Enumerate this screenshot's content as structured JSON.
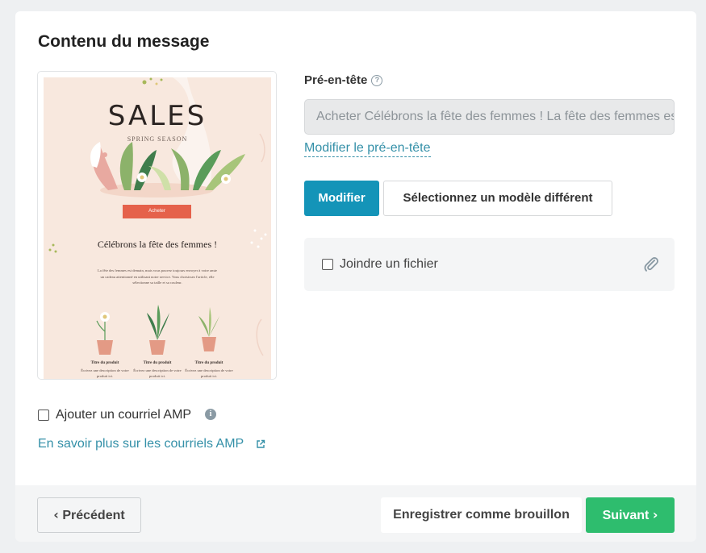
{
  "section": {
    "title": "Contenu du message"
  },
  "preview": {
    "sales_title": "SALES",
    "sales_subtitle": "SPRING SEASON",
    "button_label": "Acheter",
    "headline": "Célébrons la fête des femmes !",
    "body": "La fête des femmes est demain, mais vous pouvez toujours envoyer à votre amie un cadeau attentionné en utilisant notre service. Vous choisissez l'article, elle sélectionne sa taille et sa couleur.",
    "products": [
      {
        "title": "Titre du produit",
        "desc": "Écrivez une description de votre produit ici."
      },
      {
        "title": "Titre du produit",
        "desc": "Écrivez une description de votre produit ici."
      },
      {
        "title": "Titre du produit",
        "desc": "Écrivez une description de votre produit ici."
      }
    ],
    "colors": {
      "background": "#f8e8de",
      "button": "#e5614b"
    }
  },
  "preheader": {
    "label": "Pré-en-tête",
    "help_icon": "question-circle-icon",
    "value": "Acheter Célébrons la fête des femmes ! La fête des femmes est demain",
    "edit_link": "Modifier le pré-en-tête"
  },
  "actions": {
    "modify": "Modifier",
    "select_template": "Sélectionnez un modèle différent"
  },
  "attachment": {
    "label": "Joindre un fichier",
    "checked": false,
    "icon": "paperclip-icon"
  },
  "amp": {
    "label": "Ajouter un courriel AMP",
    "checked": false,
    "info_icon": "info-icon",
    "learn_more": "En savoir plus sur les courriels AMP",
    "external_icon": "external-link-icon"
  },
  "footer": {
    "previous": "Précédent",
    "save_draft": "Enregistrer comme brouillon",
    "next": "Suivant"
  },
  "theme": {
    "primary": "#1494b8",
    "success": "#2ebd6e",
    "link": "#3490a8"
  }
}
